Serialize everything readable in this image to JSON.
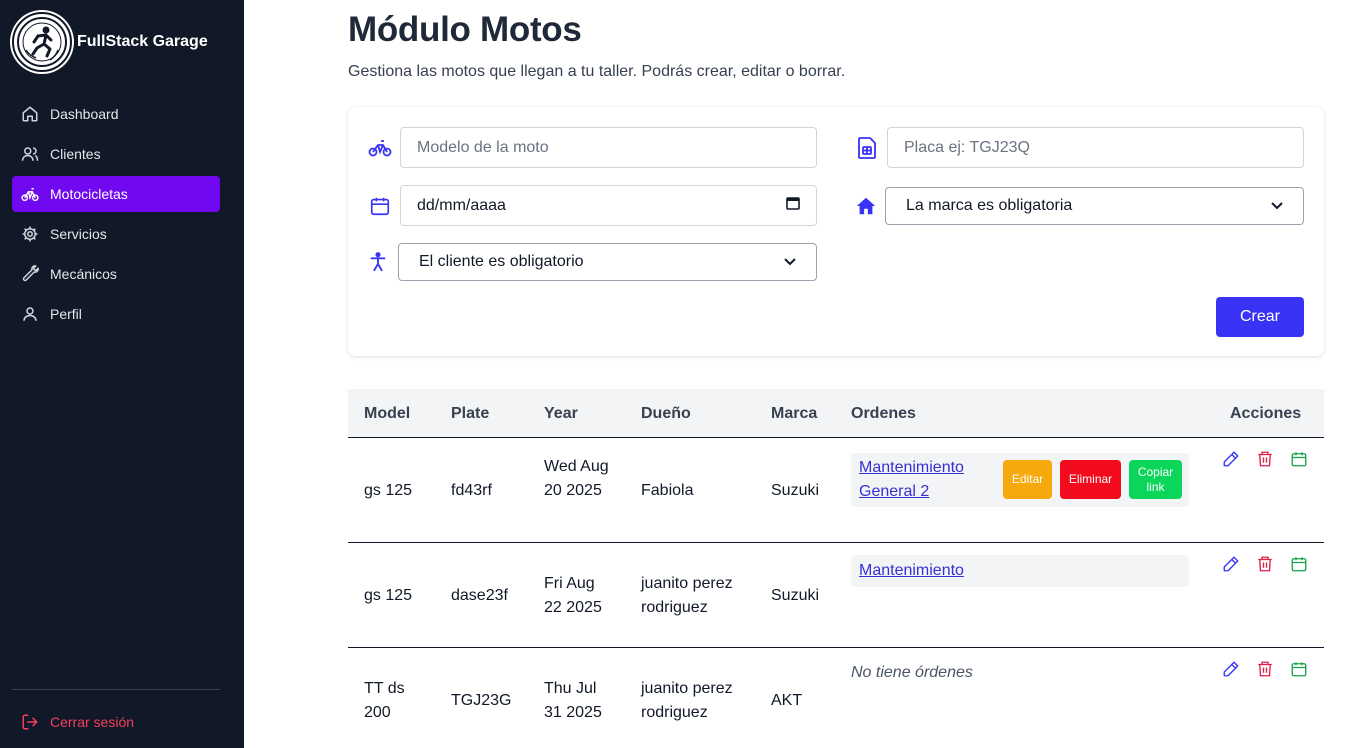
{
  "sidebar": {
    "brand": "FullStack Garage",
    "items": [
      {
        "label": "Dashboard",
        "icon": "home-icon"
      },
      {
        "label": "Clientes",
        "icon": "users-icon"
      },
      {
        "label": "Motocicletas",
        "icon": "bicycle-icon"
      },
      {
        "label": "Servicios",
        "icon": "gear-icon"
      },
      {
        "label": "Mecánicos",
        "icon": "wrench-icon"
      },
      {
        "label": "Perfil",
        "icon": "user-icon"
      }
    ],
    "active": "Motocicletas",
    "logout": "Cerrar sesión"
  },
  "page": {
    "title": "Módulo Motos",
    "subtitle": "Gestiona las motos que llegan a tu taller. Podrás crear, editar o borrar."
  },
  "form": {
    "model_placeholder": "Modelo de la moto",
    "plate_placeholder": "Placa ej: TGJ23Q",
    "date_value": "dd/mm/aaaa",
    "brand_select": "La marca es obligatoria",
    "client_select": "El cliente es obligatorio",
    "submit": "Crear"
  },
  "table": {
    "headers": [
      "Model",
      "Plate",
      "Year",
      "Dueño",
      "Marca",
      "Ordenes",
      "Acciones"
    ],
    "rows": [
      {
        "model": "gs 125",
        "plate": "fd43rf",
        "year": "Wed Aug 20 2025",
        "owner": "Fabiola",
        "brand": "Suzuki",
        "order": "Mantenimiento General 2"
      },
      {
        "model": "gs 125",
        "plate": "dase23f",
        "year": "Fri Aug 22 2025",
        "owner": "juanito perez rodriguez",
        "brand": "Suzuki",
        "order": "Mantenimiento"
      },
      {
        "model": "TT ds 200",
        "plate": "TGJ23G",
        "year": "Thu Jul 31 2025",
        "owner": "juanito perez rodriguez",
        "brand": "AKT",
        "order": ""
      }
    ],
    "order_actions": {
      "edit": "Editar",
      "delete": "Eliminar",
      "copy": "Copiar link"
    },
    "no_orders": "No tiene órdenes"
  },
  "colors": {
    "sidebar_bg": "#111827",
    "active_item": "#7008f0",
    "primary_button": "#3833f5",
    "edit_orange": "#f5a90b",
    "delete_red": "#f20b1c",
    "copy_green": "#0bd65a",
    "logout_red": "#f43f5e"
  }
}
